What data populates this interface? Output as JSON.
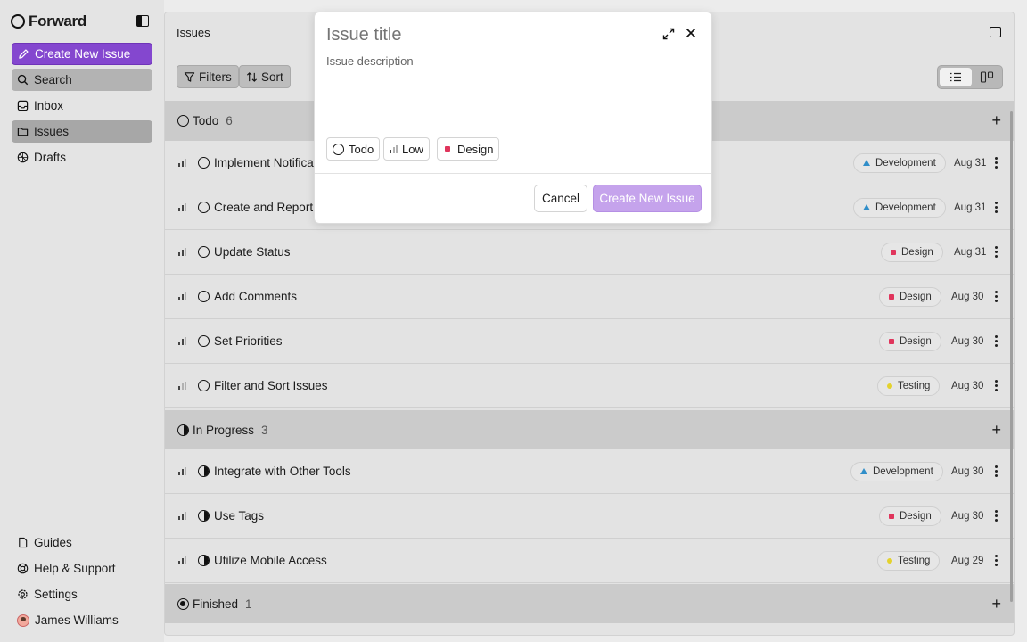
{
  "app": {
    "name": "Forward"
  },
  "sidebar": {
    "create_label": "Create New Issue",
    "search_label": "Search",
    "inbox_label": "Inbox",
    "issues_label": "Issues",
    "drafts_label": "Drafts",
    "guides_label": "Guides",
    "help_label": "Help & Support",
    "settings_label": "Settings",
    "user_name": "James Williams"
  },
  "main": {
    "title": "Issues",
    "filters_label": "Filters",
    "sort_label": "Sort",
    "view_selected": "list"
  },
  "groups": [
    {
      "name": "Todo",
      "count": "6"
    },
    {
      "name": "In Progress",
      "count": "3"
    },
    {
      "name": "Finished",
      "count": "1"
    }
  ],
  "issues": [
    {
      "title": "Implement Notificat",
      "tag": "Development",
      "date": "Aug 31",
      "status": "todo",
      "priority": "medium"
    },
    {
      "title": "Create and Report I",
      "tag": "Development",
      "date": "Aug 31",
      "status": "todo",
      "priority": "medium"
    },
    {
      "title": "Update Status",
      "tag": "Design",
      "date": "Aug 31",
      "status": "todo",
      "priority": "medium"
    },
    {
      "title": "Add Comments",
      "tag": "Design",
      "date": "Aug 30",
      "status": "todo",
      "priority": "medium"
    },
    {
      "title": "Set Priorities",
      "tag": "Design",
      "date": "Aug 30",
      "status": "todo",
      "priority": "medium"
    },
    {
      "title": "Filter and Sort Issues",
      "tag": "Testing",
      "date": "Aug 30",
      "status": "todo",
      "priority": "low"
    },
    {
      "title": "Integrate with Other Tools",
      "tag": "Development",
      "date": "Aug 30",
      "status": "in-progress",
      "priority": "medium"
    },
    {
      "title": "Use Tags",
      "tag": "Design",
      "date": "Aug 30",
      "status": "in-progress",
      "priority": "medium"
    },
    {
      "title": "Utilize Mobile Access",
      "tag": "Testing",
      "date": "Aug 29",
      "status": "in-progress",
      "priority": "medium"
    }
  ],
  "modal": {
    "title_placeholder": "Issue title",
    "description_placeholder": "Issue description",
    "status_chip": "Todo",
    "priority_chip": "Low",
    "tag_chip": "Design",
    "cancel_label": "Cancel",
    "submit_label": "Create New Issue"
  },
  "colors": {
    "accent": "#8447cf",
    "accent_disabled": "#c5a3ec",
    "design_tag": "#e0355c",
    "development_tag": "#2f8ec9",
    "testing_tag": "#e4d22d"
  }
}
